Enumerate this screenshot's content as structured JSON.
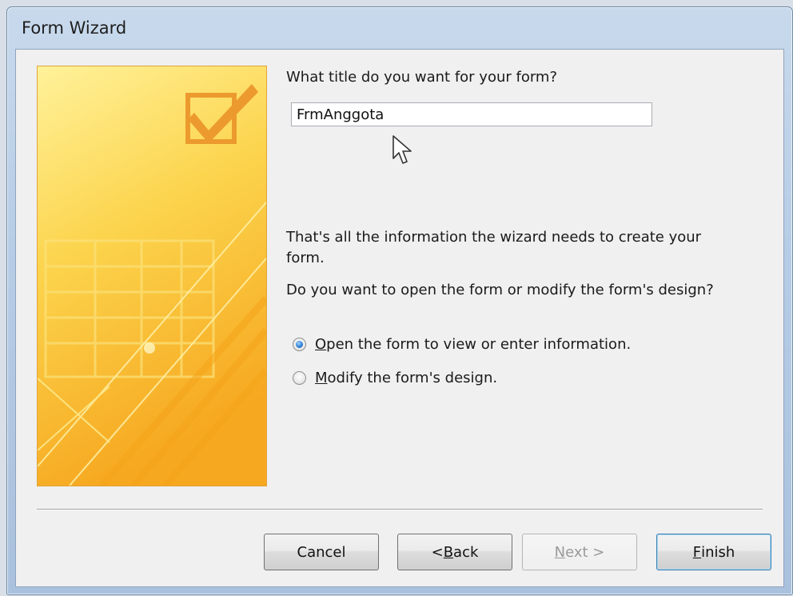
{
  "window": {
    "title": "Form Wizard"
  },
  "form": {
    "title_question": "What title do you want for your form?",
    "title_value": "FrmAnggota",
    "info_text": "That's all the information the wizard needs to create your form.",
    "open_question": "Do you want to open the form or modify the form's design?"
  },
  "options": [
    {
      "mnemonic": "O",
      "rest": "pen the form to view or enter information.",
      "selected": true
    },
    {
      "mnemonic": "M",
      "rest": "odify the form's design.",
      "selected": false
    }
  ],
  "buttons": {
    "cancel": "Cancel",
    "back_prefix": "< ",
    "back_mnemonic": "B",
    "back_rest": "ack",
    "next_mnemonic": "N",
    "next_rest": "ext >",
    "finish_mnemonic": "F",
    "finish_rest": "inish"
  },
  "colors": {
    "art_light": "#fde97a",
    "art_dark": "#f7b21c",
    "check": "#ec9a2e"
  },
  "icons": {
    "art_check": "checkbox-check-icon",
    "pointer": "mouse-pointer-icon"
  }
}
